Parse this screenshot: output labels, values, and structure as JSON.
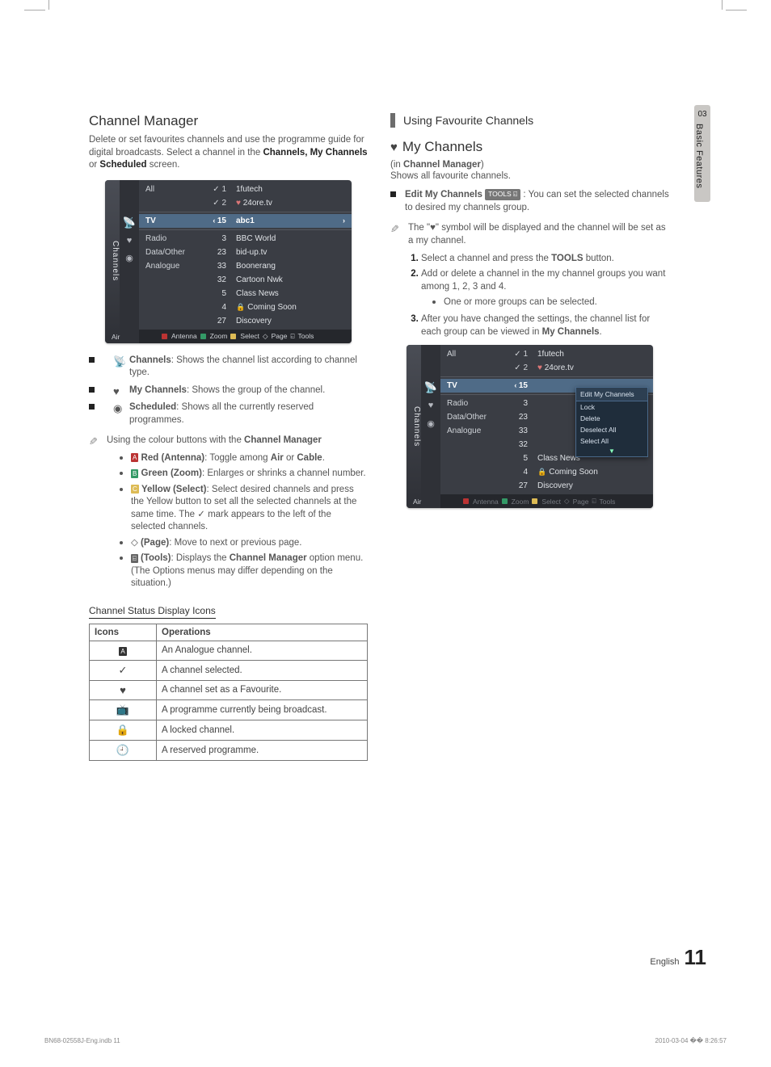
{
  "sideTab": {
    "num": "03",
    "label": "Basic Features"
  },
  "left": {
    "heading": "Channel Manager",
    "intro_a": "Delete or set favourites channels and use the programme guide for digital broadcasts. Select a channel in the ",
    "intro_b": "Channels, My Channels",
    "intro_c": " or ",
    "intro_d": "Scheduled",
    "intro_e": " screen.",
    "bullets": [
      {
        "icon": "📡",
        "term": "Channels",
        "text": ": Shows the channel list according to channel type."
      },
      {
        "icon": "♥",
        "term": "My Channels",
        "text": ": Shows the group of the channel."
      },
      {
        "icon": "◉",
        "term": "Scheduled",
        "text": ": Shows all the currently reserved programmes."
      }
    ],
    "note_lead": "Using the colour buttons with the ",
    "note_bold": "Channel Manager",
    "colour": [
      {
        "glyph": "A",
        "colour": "#b33",
        "term": "Red (Antenna)",
        "text": ": Toggle among ",
        "b2": "Air",
        "mid": " or ",
        "b3": "Cable",
        "tail": "."
      },
      {
        "glyph": "B",
        "colour": "#396",
        "term": "Green (Zoom)",
        "text": ": Enlarges or shrinks a channel number."
      },
      {
        "glyph": "C",
        "colour": "#db5",
        "term": "Yellow (Select)",
        "text": ": Select desired channels and press the Yellow button to set all the selected channels at the same time. The ✓ mark appears to the left of the selected channels."
      },
      {
        "glyph": "◇",
        "colour": "",
        "term": "(Page)",
        "text": ": Move to next or previous page."
      },
      {
        "glyph": "T",
        "colour": "#777",
        "term": "(Tools)",
        "text": ": Displays the ",
        "b2": "Channel Manager",
        "tail": " option menu. (The Options menus may differ depending on the situation.)"
      }
    ],
    "status_title": "Channel Status Display Icons",
    "status_headers": {
      "icons": "Icons",
      "ops": "Operations"
    },
    "status_rows": [
      {
        "icon": "A",
        "op": "An Analogue channel."
      },
      {
        "icon": "✓",
        "op": "A channel selected."
      },
      {
        "icon": "♥",
        "op": "A channel set as a Favourite."
      },
      {
        "icon": "▭",
        "op": "A programme currently being broadcast."
      },
      {
        "icon": "🔒",
        "op": "A locked channel."
      },
      {
        "icon": "🕘",
        "op": "A reserved programme."
      }
    ]
  },
  "cm1": {
    "side": "Channels",
    "rows_top": [
      {
        "type": "All",
        "num1": "✓ 1",
        "num2": "✓ 2",
        "name1": "1futech",
        "name2": "24ore.tv",
        "fav": true
      }
    ],
    "hl": {
      "type": "TV",
      "num": "15",
      "name": "abc1"
    },
    "rows": [
      {
        "type": "Radio",
        "num": "3",
        "name": "BBC World"
      },
      {
        "type": "Data/Other",
        "num": "23",
        "name": "bid-up.tv"
      },
      {
        "type": "Analogue",
        "num": "33",
        "name": "Boonerang"
      },
      {
        "type": "",
        "num": "32",
        "name": "Cartoon Nwk"
      },
      {
        "type": "",
        "num": "5",
        "name": "Class News"
      },
      {
        "type": "",
        "num": "4",
        "name": "Coming Soon",
        "lock": true
      },
      {
        "type": "",
        "num": "27",
        "name": "Discovery"
      }
    ],
    "footer": {
      "air": "Air",
      "antenna": "Antenna",
      "zoom": "Zoom",
      "select": "Select",
      "page": "Page",
      "tools": "Tools"
    }
  },
  "right": {
    "section": "Using Favourite Channels",
    "h_icon": "♥",
    "heading": "My Channels",
    "sub_a": "(in ",
    "sub_b": "Channel Manager",
    "sub_c": ")",
    "sub2": "Shows all favourite channels.",
    "edit_label": "Edit My Channels",
    "tools_badge": "TOOLS ⍇",
    "edit_text": ": You can set the selected channels to desired my channels group.",
    "note_a": "The \"",
    "note_b": "♥",
    "note_c": "\" symbol will be displayed and the channel will be set as a my channel.",
    "steps": [
      {
        "text_a": "Select a channel and press the ",
        "b": "TOOLS",
        "text_b": " button."
      },
      {
        "text_a": "Add or delete a channel in the my channel groups you want among 1, 2, 3 and 4."
      },
      {
        "text_a": "After you have changed the settings, the channel list for each group can be viewed in ",
        "b": "My Channels",
        "text_b": "."
      }
    ],
    "substep": "One or more groups can be selected."
  },
  "cm2": {
    "side": "Channels",
    "rows_top": [
      {
        "type": "All",
        "num1": "✓ 1",
        "num2": "✓ 2",
        "name1": "1futech",
        "name2": "24ore.tv",
        "fav": true
      }
    ],
    "hl": {
      "type": "TV",
      "num": "15"
    },
    "dropdown": {
      "header": "Edit My Channels",
      "items": [
        "Lock",
        "Delete",
        "Deselect All",
        "Select All"
      ]
    },
    "rows": [
      {
        "type": "Radio",
        "num": "3"
      },
      {
        "type": "Data/Other",
        "num": "23"
      },
      {
        "type": "Analogue",
        "num": "33"
      },
      {
        "type": "",
        "num": "32"
      },
      {
        "type": "",
        "num": "5",
        "name": "Class News"
      },
      {
        "type": "",
        "num": "4",
        "name": "Coming Soon",
        "lock": true
      },
      {
        "type": "",
        "num": "27",
        "name": "Discovery"
      }
    ],
    "footer": {
      "air": "Air",
      "antenna": "Antenna",
      "zoom": "Zoom",
      "select": "Select",
      "page": "Page",
      "tools": "Tools"
    }
  },
  "pageFooter": {
    "lang": "English",
    "num": "11"
  },
  "meta": {
    "left": "BN68-02558J-Eng.indb   11",
    "right": "2010-03-04   �� 8:26:57"
  }
}
